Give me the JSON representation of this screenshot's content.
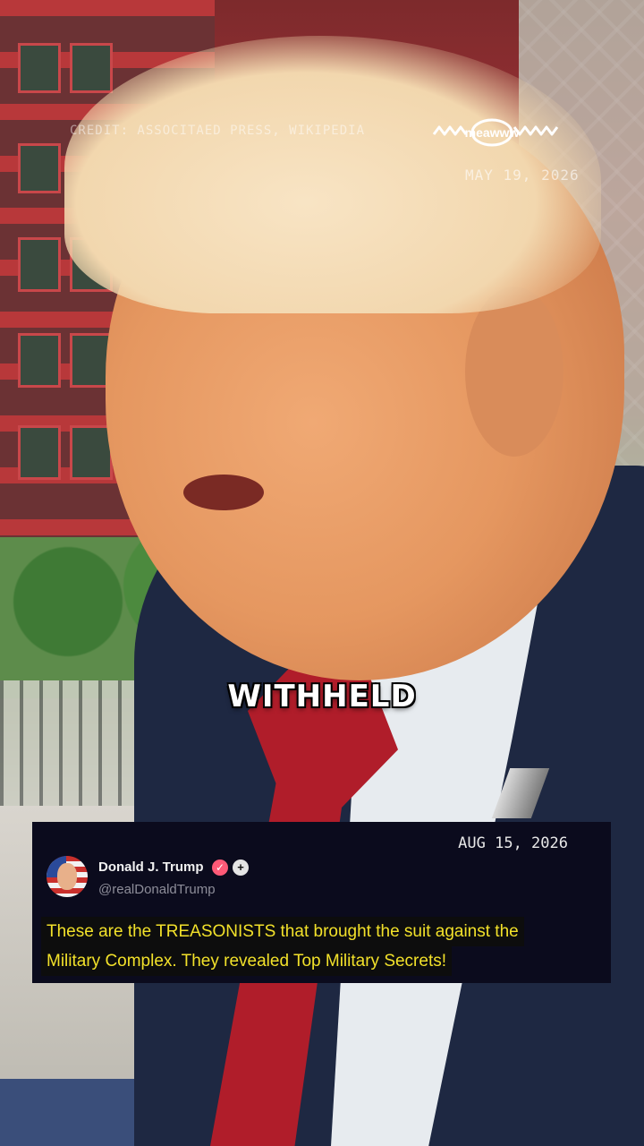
{
  "overlay": {
    "credit": "CREDIT: ASSOCITAED PRESS, WIKIPEDIA",
    "brand": "meawww",
    "date": "MAY 19, 2026",
    "caption": "WITHHELD"
  },
  "post": {
    "date": "AUG 15, 2026",
    "author_name": "Donald J. Trump",
    "author_handle": "@realDonaldTrump",
    "verified_icon": "verified-check-icon",
    "plus_icon": "plus-icon",
    "lines": [
      "These are the TREASONISTS that brought the suit against the",
      "Military Complex. They revealed Top Military Secrets!"
    ]
  },
  "colors": {
    "post_text": "#f2e12a",
    "card_bg": "#0b0b1d",
    "verified": "#ff5a77"
  }
}
